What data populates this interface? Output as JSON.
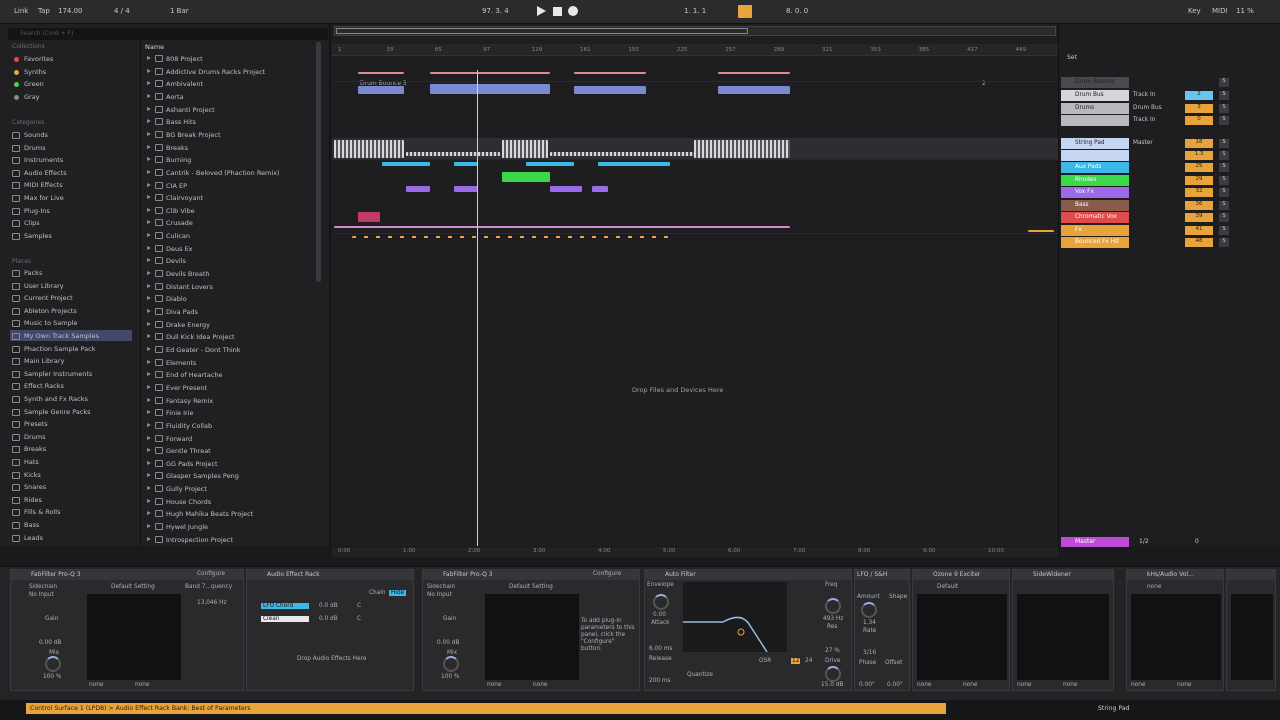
{
  "transport": {
    "link": "Link",
    "tap": "Tap",
    "tempo": "174.00",
    "signature": "4 / 4",
    "quantize": "1 Bar",
    "position": "97.   3.   4",
    "loop_start": "1.   1.   1",
    "loop_len": "8.   0.   0",
    "key": "Key",
    "midi": "MIDI",
    "cpu": "11 %"
  },
  "browser": {
    "search_placeholder": "Search (Cmd + F)",
    "collections_label": "Collections",
    "collections": [
      {
        "label": "Favorites",
        "color": "#e04a4a"
      },
      {
        "label": "Synths",
        "color": "#e8a43a"
      },
      {
        "label": "Green",
        "color": "#4ad04a"
      },
      {
        "label": "Gray",
        "color": "#8a8a8e"
      }
    ],
    "categories_label": "Categories",
    "categories": [
      "Sounds",
      "Drums",
      "Instruments",
      "Audio Effects",
      "MIDI Effects",
      "Max for Live",
      "Plug-Ins",
      "Clips",
      "Samples"
    ],
    "places_label": "Places",
    "places": [
      "Packs",
      "User Library",
      "Current Project",
      "Ableton Projects",
      "Music to Sample",
      "My Own Track Samples",
      "Phaction Sample Pack",
      "Main Library",
      "Sampler Instruments",
      "Effect Racks",
      "Synth and Fx Racks",
      "Sample Genre Packs",
      "Presets",
      "Drums",
      "Breaks",
      "Hats",
      "Kicks",
      "Snares",
      "Rides",
      "Fills & Rolls",
      "Bass",
      "Leads"
    ],
    "name_header": "Name",
    "folders": [
      "808 Project",
      "Addictive Drums Racks Project",
      "Ambivalent",
      "Aorta",
      "Ashanti Project",
      "Bass Hits",
      "BG Break Project",
      "Breaks",
      "Burning",
      "Cantrik - Beloved (Phaction Remix)",
      "CIA EP",
      "Clairvoyant",
      "Clib Vibe",
      "Crusade",
      "Culican",
      "Deus Ex",
      "Devils",
      "Devils Breath",
      "Distant Lovers",
      "Diablo",
      "Diva Pads",
      "Drake Energy",
      "Dull Kick Idea Project",
      "Ed Geater - Dont Think",
      "Elements",
      "End of Heartache",
      "Ever Present",
      "Fantasy Remix",
      "Finie Irie",
      "Fluidity Collab",
      "Forward",
      "Gentle Threat",
      "GG Pads Project",
      "Glasper Samples Peng",
      "Gully Project",
      "House Chords",
      "Hugh Mahika Beats Project",
      "Hywel Jungle",
      "Introspection Project"
    ]
  },
  "arrangement": {
    "ruler": [
      "1",
      "33",
      "65",
      "97",
      "129",
      "161",
      "193",
      "225",
      "257",
      "289",
      "321",
      "353",
      "385",
      "417",
      "449"
    ],
    "time": [
      "0:00",
      "1:00",
      "2:00",
      "3:00",
      "4:00",
      "5:00",
      "6:00",
      "7:00",
      "8:00",
      "9:00",
      "10:00"
    ],
    "clip_label": "Drum Bounce 5",
    "drop_text": "Drop Files and Devices Here",
    "marker": "2"
  },
  "mixer": {
    "set_label": "Set",
    "tracks": [
      {
        "name": "Drum Bounce",
        "color": "#4a4a4e",
        "num": "",
        "io": ""
      },
      {
        "name": "Drum Bus",
        "color": "#d6d6da",
        "num": "2",
        "io": "Track In"
      },
      {
        "name": "Drums",
        "color": "#b9b9bd",
        "num": "3",
        "io": "Drum Bus"
      },
      {
        "name": "",
        "color": "#b9b9bd",
        "num": "0",
        "io": "Track In"
      },
      {
        "name": "String Pad",
        "color": "#c6d6f0",
        "num": "18",
        "io": "Master"
      },
      {
        "name": "",
        "color": "#c6d6f0",
        "num": "1.3",
        "io": ""
      },
      {
        "name": "Aux Pads",
        "color": "#3ab8e8",
        "num": "25",
        "io": ""
      },
      {
        "name": "Rhodes",
        "color": "#3ad84a",
        "num": "29",
        "io": ""
      },
      {
        "name": "Vox Fx",
        "color": "#9a6ae8",
        "num": "32",
        "io": ""
      },
      {
        "name": "Bass",
        "color": "#8a5a4a",
        "num": "36",
        "io": ""
      },
      {
        "name": "Chromatic Vox",
        "color": "#e04a4a",
        "num": "39",
        "io": ""
      },
      {
        "name": "Fx",
        "color": "#e8a43a",
        "num": "41",
        "io": ""
      },
      {
        "name": "Bounced Fx Hit",
        "color": "#e8a43a",
        "num": "48",
        "io": ""
      }
    ],
    "master": "Master",
    "master_sel": "1/2",
    "master_vol": "0"
  },
  "devices": {
    "d1": {
      "title": "FabFilter Pro-Q 3",
      "configure": "Configure",
      "sidechain": "Sidechain",
      "no_input": "No Input",
      "gain": "Gain",
      "gain_val": "0.00 dB",
      "mix": "Mix",
      "mix_val": "100 %",
      "preset": "Default Setting",
      "band": "Band 7...quency",
      "freq": "13,046 Hz",
      "none": "none"
    },
    "d2": {
      "title": "Audio Effect Rack",
      "chain": "Chain",
      "hide": "Hide",
      "chain1": "LFO Chord",
      "chain1_val": "0.0 dB",
      "chain2": "Clean",
      "chain2_val": "0.0 dB",
      "c": "C",
      "drop": "Drop Audio Effects Here"
    },
    "d3": {
      "title": "FabFilter Pro-Q 3",
      "configure": "Configure",
      "preset": "Default Setting",
      "hint": "To add plug-in parameters to this panel, click the \"Configure\" button.",
      "none": "none"
    },
    "d4": {
      "title": "Auto Filter",
      "envelope": "Envelope",
      "env_val": "0.00",
      "attack": "Attack",
      "attack_val": "6.00 ms",
      "release": "Release",
      "release_val": "200 ms",
      "freq": "Freq",
      "freq_val": "493 Hz",
      "res": "Res",
      "res_val": "27 %",
      "drive": "Drive",
      "drive_val": "15.0 dB",
      "osr": "OSR",
      "num12": "12",
      "num24": "24",
      "quantize": "Quantize"
    },
    "d5": {
      "title": "LFO / S&H",
      "amount": "Amount",
      "amount_val": "1.34",
      "shape": "Shape",
      "rate": "Rate",
      "rate_val": "3/16",
      "phase": "Phase",
      "phase_val": "0.00°",
      "offset": "Offset",
      "offset_val": "0.00°"
    },
    "d6": {
      "title": "Ozone 9 Exciter",
      "preset": "Default",
      "none": "none"
    },
    "d7": {
      "title": "SideWidener",
      "none": "none"
    },
    "d8": {
      "title": "kHs/Audio Vol...",
      "none": "none"
    }
  },
  "status": {
    "message": "Control Surface 1 (LPD8) > Audio Effect Rack Bank: Best of Parameters",
    "track": "String Pad"
  }
}
